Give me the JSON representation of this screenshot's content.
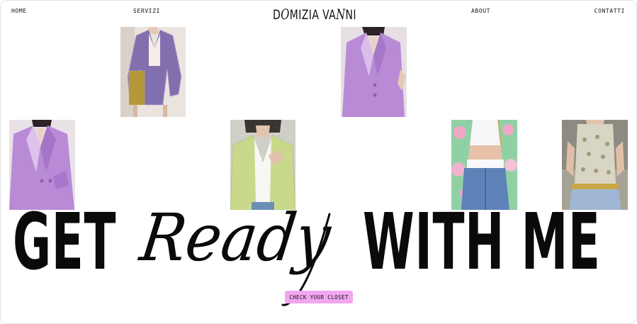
{
  "nav": {
    "home": "HOME",
    "servizi": "SERVIZI",
    "about": "ABOUT",
    "contatti": "CONTATTI"
  },
  "logo": {
    "part1": "D",
    "script1": "O",
    "part2": "MIZIA VA",
    "script2": "N",
    "part3": "NI"
  },
  "headline": {
    "word1": "GET",
    "word2": "Ready",
    "word3": "WITH ME"
  },
  "cta": {
    "label": "CHECK YOUR CLOSET",
    "color": "#f3a6f0"
  },
  "photos": [
    {
      "name": "plaid-blazer-sequin-skirt-photo",
      "palette": [
        "#efe9e3",
        "#7a6aa6",
        "#c5b0d6",
        "#b49a3c"
      ]
    },
    {
      "name": "lilac-satin-blazer-photo-1",
      "palette": [
        "#e8e1e6",
        "#b98ed6",
        "#d6b8ea",
        "#f2e9ef"
      ]
    },
    {
      "name": "lilac-satin-blazer-photo-2",
      "palette": [
        "#e9e2e8",
        "#b78bd4",
        "#d5b4e8",
        "#f1e7ee"
      ]
    },
    {
      "name": "green-tweed-jacket-photo",
      "palette": [
        "#4d4b47",
        "#c7d98a",
        "#f5f5f0",
        "#a9bd6a"
      ]
    },
    {
      "name": "floral-top-denim-photo",
      "palette": [
        "#8fd3a7",
        "#f2a6c6",
        "#f5f5f7",
        "#5f82b8"
      ]
    },
    {
      "name": "leopard-top-denim-photo",
      "palette": [
        "#8f8d84",
        "#d7d3c3",
        "#9fb6d4",
        "#c9c2a8"
      ]
    }
  ]
}
